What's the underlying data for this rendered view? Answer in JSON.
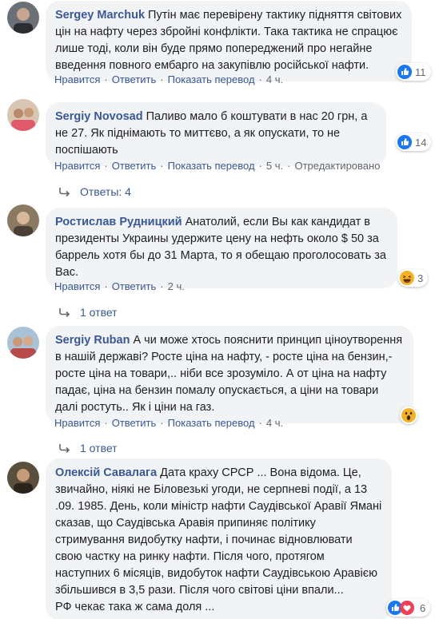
{
  "colors": {
    "link": "#385898",
    "bubble": "#f2f3f5",
    "like": "#1877f2",
    "love": "#f33e58",
    "haha": "#f7b125"
  },
  "comments": [
    {
      "author": "Sergey Marchuk",
      "text": "Путін має перевірену тактику підняття світових цін на нафту через збройні конфлікти. Така тактика не спрацює лише тоді, коли він буде прямо попереджений про негайне введення повного ембарго на закупівлю російської нафти.",
      "actions": {
        "like": "Нравится",
        "reply": "Ответить",
        "translate": "Показать перевод",
        "time": "4 ч."
      },
      "reaction": {
        "icon": "like-icon",
        "count": "11"
      }
    },
    {
      "author": "Sergiy Novosad",
      "text": "Паливо мало б коштувати в нас 20 грн, а не 27. Як піднімають то миттєво, а як опускати, то не поспішають",
      "actions": {
        "like": "Нравится",
        "reply": "Ответить",
        "translate": "Показать перевод",
        "time": "5 ч.",
        "edited": "Отредактировано"
      },
      "reaction": {
        "icon": "like-icon",
        "count": "14"
      },
      "replies": "Ответы: 4"
    },
    {
      "author": "Ростислав Рудницкий",
      "text": "Анатолий, если Вы как кандидат в президенты Украины удержите цену на нефть около $ 50 за баррель хотя бы до 31 Марта, то я обещаю проголосовать за Вас.",
      "actions": {
        "like": "Нравится",
        "reply": "Ответить",
        "time": "2 ч."
      },
      "reaction": {
        "icon": "haha-icon",
        "count": "3"
      },
      "replies": "1 ответ"
    },
    {
      "author": "Sergiy Ruban",
      "text": "А чи може хтось пояснити принцип ціноутворення в нашій державі? Росте ціна на нафту, - росте ціна на бензин,- росте ціна на товари,.. ніби все зрозуміло. А от ціна на нафту падає, ціна на бензин помалу опускається, а ціни на товари далі ростуть.. Як і ціни на газ.",
      "actions": {
        "like": "Нравится",
        "reply": "Ответить",
        "translate": "Показать перевод",
        "time": "4 ч."
      },
      "reaction": {
        "icon": "wow-icon",
        "count": ""
      },
      "replies": "1 ответ"
    },
    {
      "author": "Олексій Савалага",
      "text": "Дата краху СРСР ... Вона відома. Це, звичайно, ніякі не Біловезькі угоди, не серпневі події, а 13 .09. 1985. День, коли міністр нафти Саудівської Аравії Ямані сказав, що Саудівська Аравія припиняє політику стримування видобутку нафти, і починає відновлювати свою частку на ринку нафти. Після чого, протягом наступних 6 місяців, видобуток нафти Саудівською Аравією збільшився в 3,5 рази. Після чого світові ціни впали...",
      "text2": "РФ чекає така ж сама доля ...",
      "reaction": {
        "icon": "like-love-icons",
        "count": "6"
      }
    }
  ]
}
